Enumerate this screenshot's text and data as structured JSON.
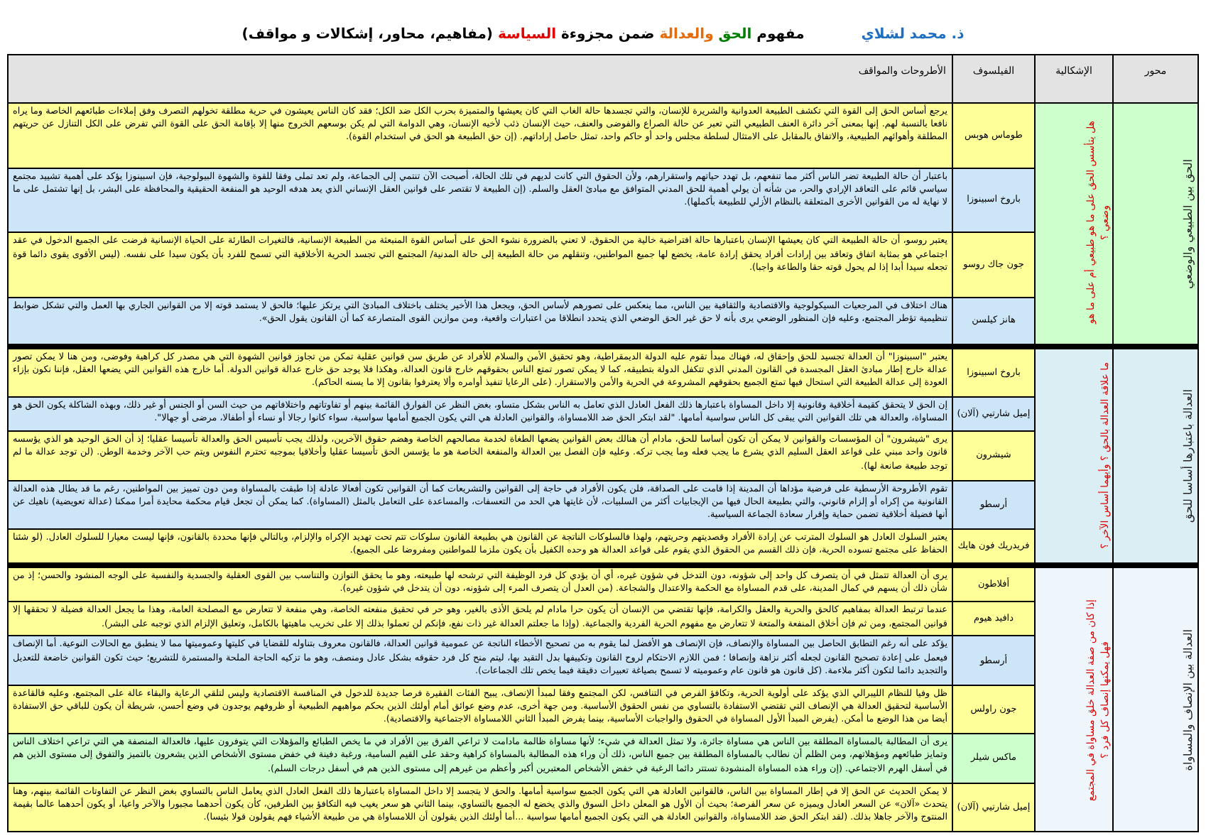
{
  "title_parts": [
    {
      "text": "مفهوم ",
      "color": "#000000"
    },
    {
      "text": "الحق ",
      "color": "#008000"
    },
    {
      "text": "والعدالة ",
      "color": "#e46c0a"
    },
    {
      "text": "ضمن مجزوءة ",
      "color": "#000000"
    },
    {
      "text": "السياسة ",
      "color": "#e00000"
    },
    {
      "text": "(مفاهيم، محاور، إشكالات و مواقف)",
      "color": "#000000"
    }
  ],
  "author": "ذ. محمد لشلاي",
  "table": {
    "columns": [
      "محور",
      "الإشكالية",
      "الفيلسوف",
      "الأطروحات والمواقف"
    ],
    "sections": [
      {
        "axis": "الحق بين الطبيعي والوضعي",
        "problem": "هل يتأسس الحق على ما هو طبيعي أم على ما هو وضعي ؟",
        "color": "#ccffcc",
        "rows": [
          {
            "philosopher": "طوماس هوبس",
            "color": "#ffff99",
            "text": "يرجع أساس الحق إلى القوة التي تكشف الطبيعة العدوانية والشريرة للإنسان، والتي تجسدها حالة الغاب التي كان يعيشها والمتميزة بحرب الكل ضد الكل؛ فقد كان الناس يعيشون في حرية مطلقة تخولهم التصرف وفق إملاءات طبائعهم الخاصة وما يراه نافعا بالنسبة لهم. إنها بمعنى آخر دائرة العنف الطبيعي التي تعبر عن حالة الصراع والفوضى والعنف، حيث الإنسان ذئب لأخيه الإنسان، وهي الدوامة التي لم يكن بوسعهم الخروج منها إلا بإقامة الحق على القوة التي تفرض على الكل التنازل عن حريتهم المطلقة وأهوائهم الطبيعية، والاتفاق بالمقابل على الامتثال لسلطة مجلس واحد أو حاكم واحد، تمثل حاصل إراداتهم. (إن حق الطبيعة هو الحق في استخدام القوة)."
          },
          {
            "philosopher": "باروخ اسبينوزا",
            "color": "#cde6f7",
            "text": "باعتبار أن حالة الطبيعة تضر الناس أكثر مما تنفعهم، بل تهدد حياتهم واستقرارهم، ولأن الحقوق التي كانت لديهم في تلك الحالة، أصبحت الآن تنتمي إلى الجماعة، ولم تعد تملى وفقا للقوة والشهوة البيولوجية، فإن اسبينوزا يؤكد على أهمية تشييد مجتمع سياسي قائم على التعاقد الإرادي والحر، من شأنه أن يولي أهمية للحق المدني المتوافق مع مبادئ العقل والسلم. (إن الطبيعة لا تقتصر على قوانين العقل الإنساني الذي يعد هدفه الوحيد هو المنفعة الحقيقية والمحافظة على البشر، بل إنها تشتمل على ما لا نهاية له من القوانين الأخرى المتعلقة بالنظام الأزلي للطبيعة بأكملها)."
          },
          {
            "philosopher": "جون جاك روسو",
            "color": "#ffff99",
            "text": "يعتبر روسو، أن حالة الطبيعة التي كان يعيشها الإنسان باعتبارها حالة افتراضية خالية من الحقوق، لا تعني بالضرورة نشوء الحق على أساس القوة المنبعثة من الطبيعة الإنسانية، فالتغيرات الطارئة على الحياة الإنسانية فرضت على الجميع الدخول في عقد اجتماعي هو بمثابة اتفاق وتعاقد بين إرادات أفراد يحقق إرادة عامة، يخضع لها جميع المواطنين، وتنقلهم من حالة الطبيعة إلى حالة المدنية/ المجتمع التي تجسد الحرية الأخلاقية التي تسمح للفرد بأن يكون سيدا على نفسه. (ليس الأقوى يقوى دائما قوة تجعله سيدا أبدا إذا لم يحول قوته حقا والطاعة واجبا)."
          },
          {
            "philosopher": "هانز كيلسن",
            "color": "#cde6f7",
            "text": "هناك اختلاف في المرجعيات السيكولوجية والاقتصادية والثقافية بين الناس، مما ينعكس على تصورهم لأساس الحق، ويجعل هذا الأخير يختلف باختلاف المبادئ التي يرتكز عليها؛ فالحق لا يستمد قوته إلا من القوانين الجاري بها العمل والتي تشكل ضوابط تنظيمية تؤطر المجتمع، وعليه فإن المنظور الوضعي يرى بأنه لا حق غير الحق الوضعي الذي يتحدد انطلاقا من اعتبارات واقعية، ومن موازين القوى المتصارعة كما أن القانون يقول الحق»."
          }
        ]
      },
      {
        "axis": "العدالة باعتبارها أساسا للحق",
        "problem": "ما علاقة العدالة بالحق ؟ وأيهما أساس الآخر ؟",
        "color": "#dbeef4",
        "rows": [
          {
            "philosopher": "باروخ اسبينوزا",
            "color": "#ffff99",
            "text": "يعتبر \"اسبينوزا\" أن العدالة تجسيد للحق وإحقاق له، فهناك مبدأ تقوم عليه الدولة الديمقراطية، وهو تحقيق الأمن والسلام للأفراد عن طريق سن قوانين عقلية تمكن من تجاوز قوانين الشهوة التي هي مصدر كل كراهية وفوضى، ومن هنا لا يمكن تصور عدالة خارج إطار مبادئ العقل المجسدة في القانون المدني الذي تتكفل الدولة بتطبيقه، كما لا يمكن تصور تمتع الناس بحقوقهم خارج قانون العدالة، وهكذا فلا يوجد حق خارج عدالة قوانين الدولة. أما خارج هذه القوانين التي يضعها العقل، فإننا نكون بإزاء العودة إلى عدالة الطبيعة التي استحال فيها تمتع الجميع بحقوقهم المشروعة في الحرية والأمن والاستقرار. (على الرعايا تنفيذ أوامره وألا يعترفوا بقانون إلا ما يسنه الحاكم)."
          },
          {
            "philosopher": "إميل شارتيي (آلان)",
            "color": "#cde6f7",
            "text": "إن الحق لا يتحقق كقيمة أخلاقية وقانونية إلا داخل المساواة باعتبارها ذلك الفعل العادل الذي تعامل به الناس بشكل متساو، بغض النظر عن الفوارق القائمة بينهم أو تفاوتاتهم واختلافاتهم من حيث السن أو الجنس أو غير ذلك، وبهذه الشاكلة يكون الحق هو المساواة، والعدالة هي تلك القوانين التي يبقى كل الناس سواسية أمامها. \"لقد ابتكر الحق ضد اللامساواة، والقوانين العادلة هي التي يكون الجميع أمامها سواسية، سواء كانوا رجالا أو نساء أو أطفالا، مرضى أو جهالا\"."
          },
          {
            "philosopher": "شيشرون",
            "color": "#ffff99",
            "text": "يرى \"شيشرون\" أن المؤسسات والقوانين لا يمكن أن تكون أساسا للحق، مادام أن هنالك بعض القوانين يضعها الطغاة لخدمة مصالحهم الخاصة وهضم حقوق الآخرين، ولذلك يجب تأسيس الحق والعدالة تأسيسا عقليا؛ إذ أن الحق الوحيد هو الذي يؤسسه قانون واحد مبني على قواعد العقل السليم الذي يشرع ما يجب فعله وما يجب تركه. وعليه فإن الفصل بين العدالة والمنفعة الخاصة هو ما يؤسس الحق تأسيسا عقليا وأخلاقيا بموجبه تحترم النفوس ويتم حب الآخر وخدمة الوطن. (لن توجد عدالة ما لم توجد طبيعة صانعة لها)."
          },
          {
            "philosopher": "أرسطو",
            "color": "#cde6f7",
            "text": "تقوم الأطروحة الأرسطية على فرضية مؤداها أن المدينة إذا قامت على الصداقة، فلن يكون الأفراد في حاجة إلى القوانين والتشريعات كما أن القوانين تكون أفعالا عادلة إذا طبقت بالمساواة ومن دون تمييز بين المواطنين، رغم ما قد يطال هذه العدالة القانونية من إكراه أو إلزام قانوني، والتي بطبيعة الحال فيها من الإيجابيات أكثر من السلبيات، لأن غايتها هي الحد من التعسفات، والمساعدة على التعامل بالمثل (المساواة). كما يمكن أن تجعل قيام محكمة محايدة أمرا ممكنا (عدالة تعويضية) ناهيك عن أنها فضيلة أخلاقية تضمن حماية وإقرار سعادة الجماعة السياسية."
          },
          {
            "philosopher": "فريدريك فون هايك",
            "color": "#ffff99",
            "text": "يعتبر السلوك العادل هو السلوك المترتب عن إرادة الأفراد وقصديتهم وحريتهم، ولهذا فالسلوكات الناتجة عن القانون هي بطبيعة القانون سلوكات تتم تحت تهديد الإكراه والإلزام، وبالتالي فإنها محددة بالقانون، فإنها ليست معيارا للسلوك العادل. (لو شئنا الحفاظ على مجتمع تسوده الحرية، فإن ذلك القسم من الحقوق الذي يقوم على قواعد العدالة هو وحده الكفيل بأن يكون ملزما للمواطنين ومفروضا على الجميع)."
          }
        ]
      },
      {
        "axis": "العدالة بين الإنصاف والمساواة",
        "problem": "إذا كان من صفة العدالة خلق مساواة في المجتمع فهل يمكنها إنصاف كل فرد ؟",
        "color": "#eef6fb",
        "rows": [
          {
            "philosopher": "أفلاطون",
            "color": "#ffff99",
            "text": "يرى أن العدالة تتمثل في أن يتصرف كل واحد إلى شؤونه، دون التدخل في شؤون غيره، أي أن يؤدي كل فرد الوظيفة التي ترشحه لها طبيعته، وهو ما يحقق التوازن والتناسب بين القوى العقلية والجسدية والنفسية على الوجه المنشود والحسن؛ إذ من شأن ذلك أن يسهم في كمال المدينة، على قدم المساواة مع الحكمة والاعتدال والشجاعة. (من العدل أن يتصرف المرء إلى شؤونه، دون أن يتدخل في شؤون غيره)."
          },
          {
            "philosopher": "دافيد هيوم",
            "color": "#ffff99",
            "text": "عندما ترتبط العدالة بمفاهيم كالحق والحرية والعقل والكرامة، فإنها تقتضي من الإنسان أن يكون حرا مادام لم يلحق الأذى بالغير، وهو حر في تحقيق منفعته الخاصة، وهي منفعة لا تتعارض مع المصلحة العامة، وهذا ما يجعل العدالة فضيلة لا تحققها إلا قوانين المجتمع، ومن ثم فإن أخلاق المنفعة والمتعة لا تتعارض مع مفهوم الحرية الفردية والجماعية. (وإذا ما جعلتم العدالة غير ذات نفع، فإنكم لن تعملوا بذلك إلا على تخريب ماهيتها بالكامل، وتعليق الإلزام الذي توجبه على البشر)."
          },
          {
            "philosopher": "أرسطو",
            "color": "#cde6f7",
            "text": "يؤكد على أنه رغم التطابق الحاصل بين المساواة والإنصاف، فإن الإنصاف هو الأفضل لما يقوم به من تصحيح الأخطاء الناتجة عن عمومية قوانين العدالة، فالقانون معروف بتناوله للقضايا في كليتها وعموميتها مما لا ينطبق مع الحالات النوعية. أما الإنصاف فيعمل على إعادة تصحيح القانون لجعله أكثر نزاهة وإنصافا ؛ فمن اللازم الاحتكام لروح القانون وتكييفها بدل التقيد بها، ليتم منح كل فرد حقوقه بشكل عادل ومنصف، وهو ما تزكيه الحاجة الملحة والمستمرة للتشريع؛ حيث تكون القوانين خاضعة للتعديل والتجديد دائما لتكون أكثر ملاءمة. (كل قانون هو قانون عام وعموميته لا تسمح بصياغة تعبيرات دقيقة فيما يخص تلك الجماعات)."
          },
          {
            "philosopher": "جون راولس",
            "color": "#ffff99",
            "text": "ظل وفيا للنظام الليبرالي الذي يؤكد على أولوية الحرية، وتكافؤ الفرص في التنافس، لكن المجتمع وفقا لمبدأ الإنصاف، يبيح الفئات الفقيرة فرصا جديدة للدخول في المنافسة الاقتصادية وليس لتلقي الرعاية والبقاء عالة على المجتمع، وعليه فالقاعدة الأساسية لتحقيق العدالة هي الإنصاف التي تقتضي الاستفادة بالتساوي من نفس الحقوق الأساسية. ومن جهة أخرى، عدم وضع عوائق أمام أولئك الذين بحكم مواهبهم الطبيعية أو ظروفهم يوجدون في وضع أحسن، شريطة أن يكون للباقي حق الاستفادة أيضا من هذا الوضع ما أمكن. (يفرض المبدأ الأول المساواة في الحقوق والواجبات الأساسية، بينما يفرض المبدأ الثاني اللامساواة الاجتماعية والاقتصادية)."
          },
          {
            "philosopher": "ماكس شيلر",
            "color": "#ccffcc",
            "text": "يرى أن المطالبة بالمساواة المطلقة بين الناس هي مساواة جائرة، ولا تمثل العدالة في شيء؛ لأنها مساواة ظالمة مادامت لا تراعي الفرق بين الأفراد في ما يخص الطبائع والمؤهلات التي يتوفرون عليها، فالعدالة المنصفة هي التي تراعي اختلاف الناس وتمايز طبائعهم ومؤهلاتهم، ومن الظلم أن نطالب بالمساواة المطلقة بين جميع الناس، ذلك أن وراء هذه المطالبة بالمساواة كراهية وحقد على القيم السامية، ورغبة دفينة في خفض مستوى الأشخاص الذين يشعرون بالتميز والتفوق إلى مستوى الذين هم في أسفل الهرم الاجتماعي. (إن وراء هذه المساواة المنشودة تستتر دائما الرغبة في خفض الأشخاص المعتبرين أكبر وأعظم من غيرهم إلى مستوى الذين هم في أسفل درجات السلم)."
          },
          {
            "philosopher": "إميل شارتيي (آلان)",
            "color": "#ffff99",
            "text": "لا يمكن الحديث عن الحق إلا في إطار المساواة بين الناس، فالقوانين العادلة هي التي يكون الجميع سواسية أمامها. والحق لا يتجسد إلا داخل المساواة باعتبارها ذلك الفعل العادل الذي يعامل الناس بالتساوي بغض النظر عن التفاوتات القائمة بينهم، وهنا يتحدث «آلان» عن السعر العادل ويميزه عن سعر الفرصة؛ بحيث أن الأول هو المعلن داخل السوق والذي يخضع له الجميع بالتساوي، بينما الثاني هو سعر يغيب فيه التكافؤ بين الطرفين، كأن يكون أحدهما مجبورا والآخر واعيا، أو يكون أحدهما عالما بقيمة المنتوج والآخر جاهلا بذلك. (لقد ابتكر الحق ضد اللامساواة، والقوانين العادلة هي التي يكون الجميع أمامها سواسية ...أما أولئك الذين يقولون أن اللامساواة هي من طبيعة الأشياء فهم يقولون قولا بئيسا)."
          }
        ]
      }
    ]
  }
}
